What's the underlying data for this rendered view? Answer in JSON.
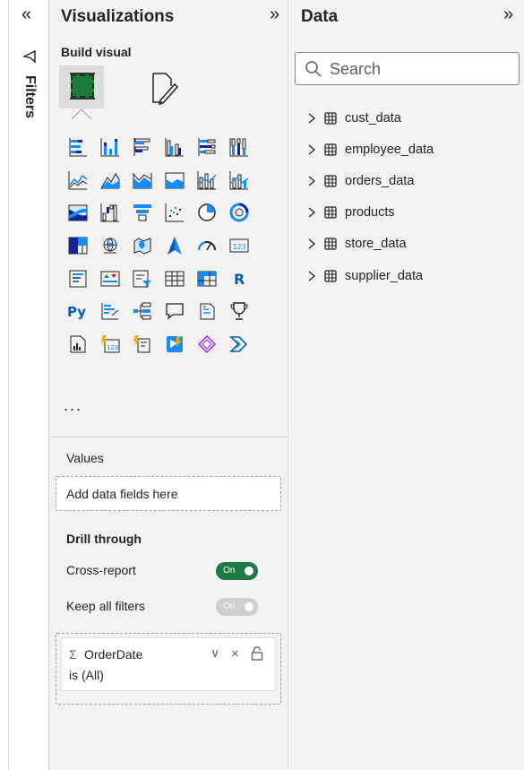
{
  "filters": {
    "collapse_glyph": "«",
    "label": "Filters",
    "icon": "filter-icon"
  },
  "visualizations": {
    "title": "Visualizations",
    "expand_glyph": "»",
    "build_visual_label": "Build visual",
    "more_label": "...",
    "grid_icons": [
      [
        "stacked-bar-chart-icon",
        "stacked-column-chart-icon",
        "clustered-bar-chart-icon",
        "clustered-column-chart-icon",
        "100-stacked-bar-chart-icon",
        "100-stacked-column-chart-icon"
      ],
      [
        "line-chart-icon",
        "area-chart-icon",
        "stacked-area-chart-icon",
        "100-stacked-area-chart-icon",
        "line-and-stacked-column-chart-icon",
        "line-and-clustered-column-chart-icon"
      ],
      [
        "ribbon-chart-icon",
        "waterfall-chart-icon",
        "funnel-chart-icon",
        "scatter-chart-icon",
        "pie-chart-icon",
        "donut-chart-icon"
      ],
      [
        "treemap-icon",
        "map-icon",
        "filled-map-icon",
        "azure-map-icon",
        "gauge-icon",
        "card-icon"
      ],
      [
        "multi-row-card-icon",
        "kpi-icon",
        "slicer-icon",
        "table-icon",
        "matrix-icon",
        "r-visual-icon"
      ],
      [
        "python-visual-icon",
        "key-influencers-icon",
        "decomposition-tree-icon",
        "qa-icon",
        "smart-narrative-icon",
        "goals-icon"
      ],
      [
        "paginated-report-icon",
        "new-card-icon",
        "new-slicer-icon",
        "power-apps-icon",
        "power-automate-icon",
        "more-power-automate-icon"
      ]
    ],
    "values_label": "Values",
    "values_placeholder": "Add data fields here",
    "drill_through_label": "Drill through",
    "cross_report_label": "Cross-report",
    "cross_report_toggle": "On",
    "keep_filters_label": "Keep all filters",
    "keep_filters_toggle": "On",
    "drill_field": {
      "sigma": "Σ",
      "name": "OrderDate",
      "filter": "is (All)",
      "chevron": "∨",
      "remove": "×"
    }
  },
  "data_pane": {
    "title": "Data",
    "expand_glyph": "»",
    "search_placeholder": "Search",
    "tables": [
      {
        "name": "cust_data"
      },
      {
        "name": "employee_data"
      },
      {
        "name": "orders_data"
      },
      {
        "name": "products"
      },
      {
        "name": "store_data"
      },
      {
        "name": "supplier_data"
      }
    ]
  },
  "colors": {
    "pane_bg": "#f3f2f1",
    "toggle_on": "#1e7a45",
    "toggle_off": "#d0cfce",
    "accent_blue": "#118dff"
  }
}
